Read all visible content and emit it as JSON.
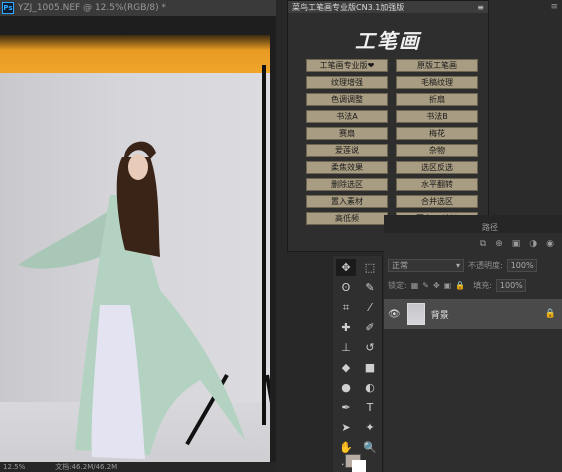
{
  "document": {
    "ps_logo": "Ps",
    "title": "YZJ_1005.NEF @ 12.5%(RGB/8) *",
    "zoom": "12.5%",
    "doc_size": "文档:46.2M/46.2M"
  },
  "plugin": {
    "header": "菜鸟工笔画专业版CN3.1加强版",
    "menu_icon": "≡",
    "logo": "工笔画",
    "buttons": [
      "工笔画专业版❤",
      "原版工笔画",
      "纹理增强",
      "毛稿纹理",
      "色调调整",
      "折扇",
      "书法A",
      "书法B",
      "赛扇",
      "梅花",
      "爱莲说",
      "杂物",
      "柔焦效果",
      "选区反选",
      "删除选区",
      "水平翻转",
      "置入素材",
      "合并选区",
      "高低频",
      "菜鸟PS论坛"
    ]
  },
  "right_strip": {
    "menu_icon": "≡"
  },
  "tools": {
    "items": [
      {
        "name": "move-tool",
        "glyph": "✥"
      },
      {
        "name": "marquee-tool",
        "glyph": "⬚"
      },
      {
        "name": "lasso-tool",
        "glyph": "ʘ"
      },
      {
        "name": "quick-select-tool",
        "glyph": "✎"
      },
      {
        "name": "crop-tool",
        "glyph": "⌗"
      },
      {
        "name": "eyedropper-tool",
        "glyph": "⁄"
      },
      {
        "name": "healing-tool",
        "glyph": "✚"
      },
      {
        "name": "brush-tool",
        "glyph": "✐"
      },
      {
        "name": "stamp-tool",
        "glyph": "⊥"
      },
      {
        "name": "history-brush-tool",
        "glyph": "↺"
      },
      {
        "name": "eraser-tool",
        "glyph": "◆"
      },
      {
        "name": "gradient-tool",
        "glyph": "■"
      },
      {
        "name": "blur-tool",
        "glyph": "●"
      },
      {
        "name": "dodge-tool",
        "glyph": "◐"
      },
      {
        "name": "pen-tool",
        "glyph": "✒"
      },
      {
        "name": "type-tool",
        "glyph": "T"
      },
      {
        "name": "path-select-tool",
        "glyph": "➤"
      },
      {
        "name": "shape-tool",
        "glyph": "✦"
      },
      {
        "name": "hand-tool",
        "glyph": "✋"
      },
      {
        "name": "zoom-tool",
        "glyph": "🔍"
      }
    ],
    "more": "···"
  },
  "layers": {
    "tab_label": "路径",
    "blend_mode": "正常",
    "opacity_label": "不透明度:",
    "opacity_value": "100%",
    "lock_label": "锁定:",
    "fill_label": "填充:",
    "fill_value": "100%",
    "layer_name": "背景",
    "header_icons": [
      "⧉",
      "⊕",
      "▣",
      "◑",
      "◉"
    ]
  }
}
